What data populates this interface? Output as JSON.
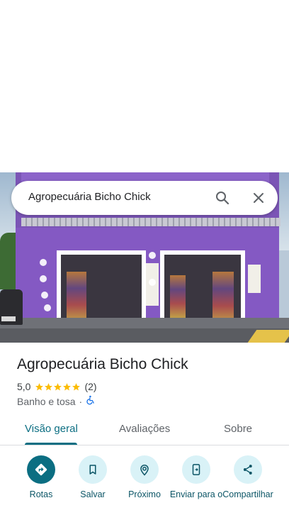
{
  "search": {
    "query": "Agropecuária Bicho Chick"
  },
  "place": {
    "name": "Agropecuária Bicho Chick",
    "rating": "5,0",
    "review_count": "(2)",
    "stars": 5,
    "category": "Banho e tosa",
    "separator": "·"
  },
  "tabs": [
    {
      "label": "Visão geral",
      "active": true
    },
    {
      "label": "Avaliações",
      "active": false
    },
    {
      "label": "Sobre",
      "active": false
    }
  ],
  "actions": [
    {
      "label": "Rotas",
      "icon": "directions-icon",
      "primary": true
    },
    {
      "label": "Salvar",
      "icon": "bookmark-icon",
      "primary": false
    },
    {
      "label": "Próximo",
      "icon": "nearby-icon",
      "primary": false
    },
    {
      "label": "Enviar para o",
      "icon": "send-to-phone-icon",
      "primary": false
    },
    {
      "label": "Compartilhar",
      "icon": "share-icon",
      "primary": false
    }
  ],
  "colors": {
    "accent": "#0b6e82",
    "star": "#fbbc04",
    "chip_bg": "#d9f2f7"
  }
}
